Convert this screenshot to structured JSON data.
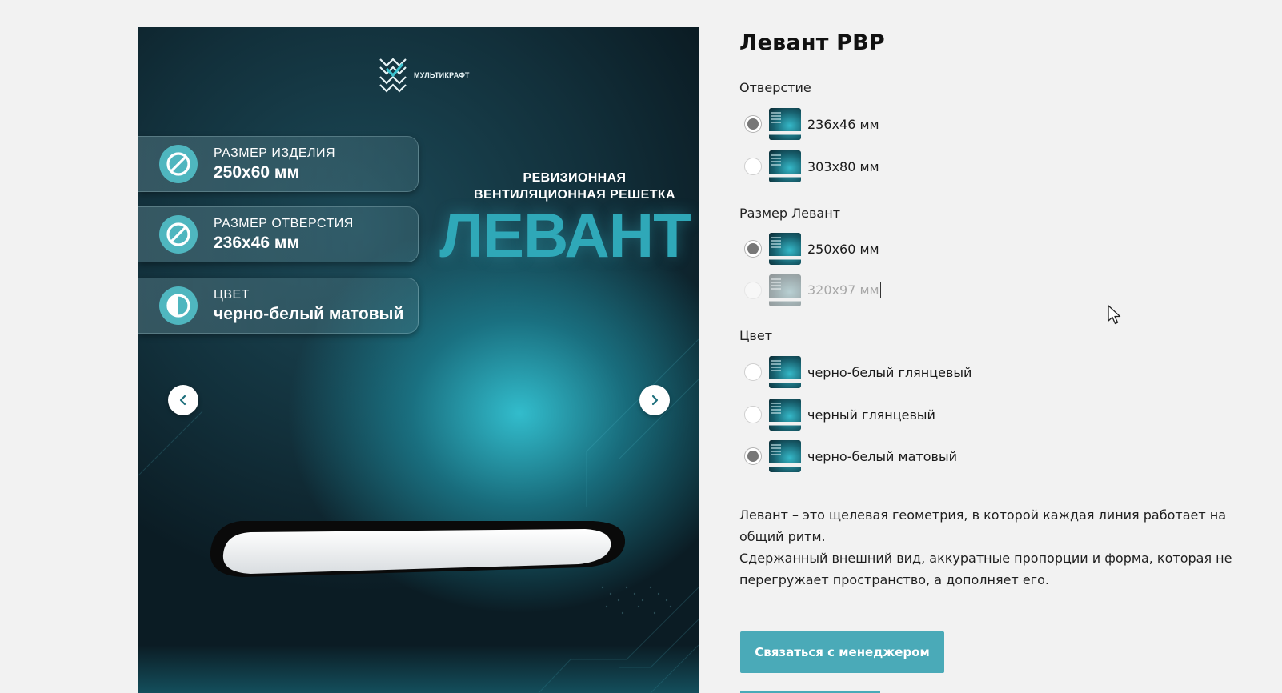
{
  "gallery": {
    "brand_name": "МУЛЬТИКРАФТ",
    "specs": [
      {
        "label": "РАЗМЕР ИЗДЕЛИЯ",
        "value": "250x60 мм",
        "icon": "diameter-icon"
      },
      {
        "label": "РАЗМЕР ОТВЕРСТИЯ",
        "value": "236x46 мм",
        "icon": "diameter-icon"
      },
      {
        "label": "ЦВЕТ",
        "value": "черно-белый матовый",
        "icon": "contrast-icon"
      }
    ],
    "headline_line1": "РЕВИЗИОННАЯ",
    "headline_line2": "ВЕНТИЛЯЦИОННАЯ РЕШЕТКА",
    "headline_big": "ЛЕВАНТ",
    "accent_color": "#2fa8b8"
  },
  "product": {
    "title": "Левант РВР",
    "option_groups": [
      {
        "label": "Отверстие",
        "options": [
          {
            "text": "236x46 мм",
            "selected": true,
            "disabled": false
          },
          {
            "text": "303x80 мм",
            "selected": false,
            "disabled": false
          }
        ]
      },
      {
        "label": "Размер Левант",
        "options": [
          {
            "text": "250x60 мм",
            "selected": true,
            "disabled": false
          },
          {
            "text": "320x97 мм",
            "selected": false,
            "disabled": true
          }
        ]
      },
      {
        "label": "Цвет",
        "options": [
          {
            "text": "черно-белый глянцевый",
            "selected": false,
            "disabled": false
          },
          {
            "text": "черный глянцевый",
            "selected": false,
            "disabled": false
          },
          {
            "text": "черно-белый матовый",
            "selected": true,
            "disabled": false
          }
        ]
      }
    ],
    "description": [
      "Левант – это щелевая геометрия, в которой каждая линия работает на общий ритм.",
      "Сдержанный внешний вид, аккуратные пропорции и форма, которая не перегружает пространство, а дополняет его."
    ],
    "cta_label": "Связаться с менеджером",
    "cta_color": "#4aaab8"
  }
}
